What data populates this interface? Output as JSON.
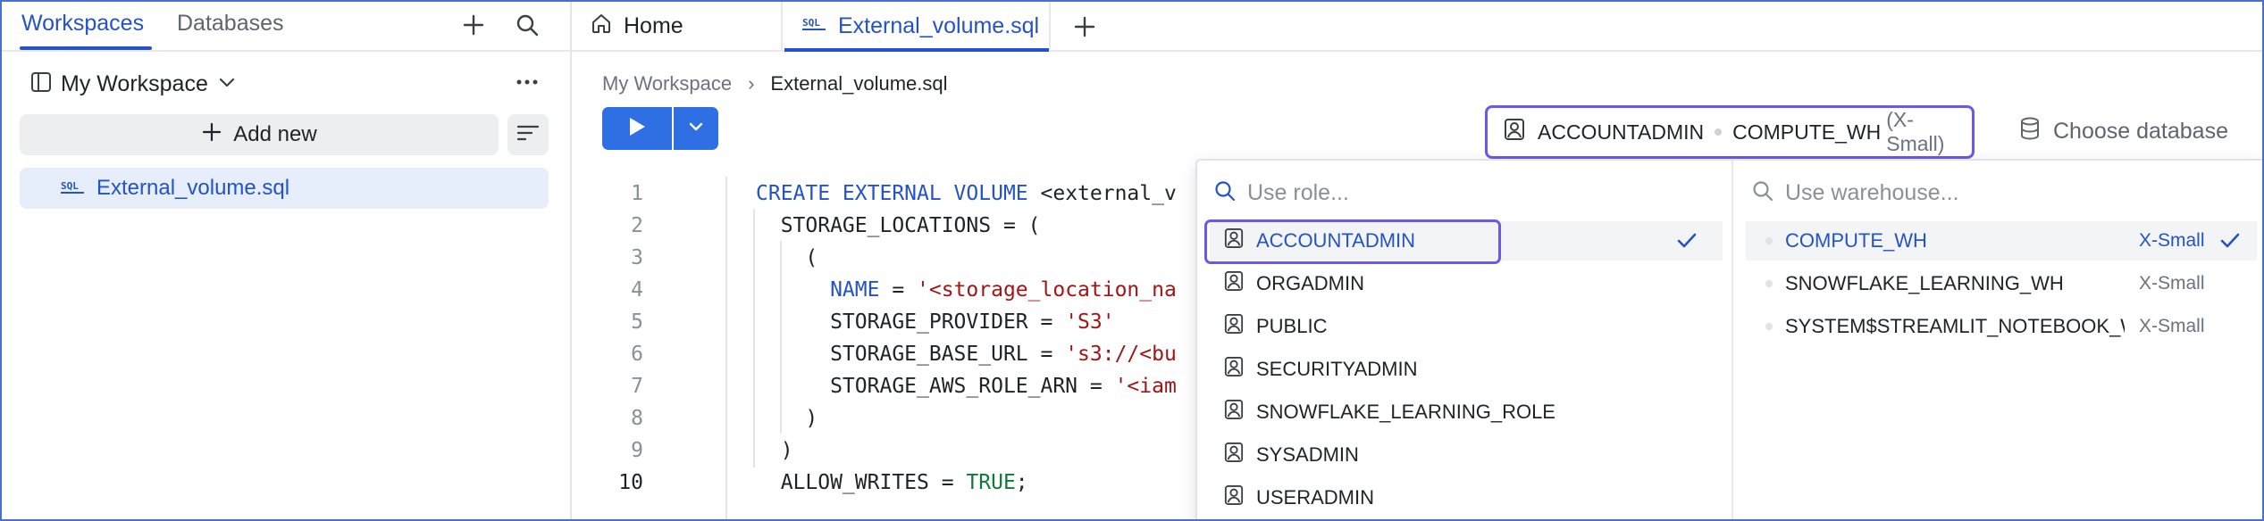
{
  "sidebar": {
    "tabs": [
      "Workspaces",
      "Databases"
    ],
    "workspace_title": "My Workspace",
    "add_new_label": "Add new",
    "files": [
      "External_volume.sql"
    ]
  },
  "editor_tabs": {
    "home": "Home",
    "file": "External_volume.sql"
  },
  "breadcrumb": {
    "root": "My Workspace",
    "separator": "›",
    "current": "External_volume.sql"
  },
  "context": {
    "role": "ACCOUNTADMIN",
    "warehouse": "COMPUTE_WH",
    "warehouse_size": "(X-Small)",
    "choose_database": "Choose database"
  },
  "code_lines": [
    {
      "n": "1",
      "parts": [
        {
          "t": "CREATE EXTERNAL VOLUME ",
          "c": "kw"
        },
        {
          "t": "<external_v",
          "c": ""
        }
      ]
    },
    {
      "n": "2",
      "parts": [
        {
          "t": "  STORAGE_LOCATIONS = (",
          "c": ""
        }
      ]
    },
    {
      "n": "3",
      "parts": [
        {
          "t": "    (",
          "c": ""
        }
      ]
    },
    {
      "n": "4",
      "parts": [
        {
          "t": "      NAME",
          "c": "kw"
        },
        {
          "t": " = ",
          "c": ""
        },
        {
          "t": "'<storage_location_na",
          "c": "str"
        }
      ]
    },
    {
      "n": "5",
      "parts": [
        {
          "t": "      STORAGE_PROVIDER = ",
          "c": ""
        },
        {
          "t": "'S3'",
          "c": "str"
        }
      ]
    },
    {
      "n": "6",
      "parts": [
        {
          "t": "      STORAGE_BASE_URL = ",
          "c": ""
        },
        {
          "t": "'s3://<bu",
          "c": "str"
        }
      ]
    },
    {
      "n": "7",
      "parts": [
        {
          "t": "      STORAGE_AWS_ROLE_ARN = ",
          "c": ""
        },
        {
          "t": "'<iam",
          "c": "str"
        }
      ]
    },
    {
      "n": "8",
      "parts": [
        {
          "t": "    )",
          "c": ""
        }
      ]
    },
    {
      "n": "9",
      "parts": [
        {
          "t": "  )",
          "c": ""
        }
      ]
    },
    {
      "n": "10",
      "parts": [
        {
          "t": "  ALLOW_WRITES = ",
          "c": ""
        },
        {
          "t": "TRUE",
          "c": "bool"
        },
        {
          "t": ";",
          "c": ""
        }
      ]
    }
  ],
  "dropdown": {
    "role_search_placeholder": "Use role...",
    "warehouse_search_placeholder": "Use warehouse...",
    "roles": [
      "ACCOUNTADMIN",
      "ORGADMIN",
      "PUBLIC",
      "SECURITYADMIN",
      "SNOWFLAKE_LEARNING_ROLE",
      "SYSADMIN",
      "USERADMIN"
    ],
    "selected_role": "ACCOUNTADMIN",
    "warehouses": [
      {
        "name": "COMPUTE_WH",
        "size": "X-Small"
      },
      {
        "name": "SNOWFLAKE_LEARNING_WH",
        "size": "X-Small"
      },
      {
        "name": "SYSTEM$STREAMLIT_NOTEBOOK_WH",
        "size": "X-Small"
      }
    ],
    "selected_warehouse": "COMPUTE_WH"
  },
  "colors": {
    "accent": "#2453c9",
    "run_button": "#2f6fe4",
    "highlight_outline": "#6b58e8",
    "selected_file_bg": "#e6eefb"
  }
}
